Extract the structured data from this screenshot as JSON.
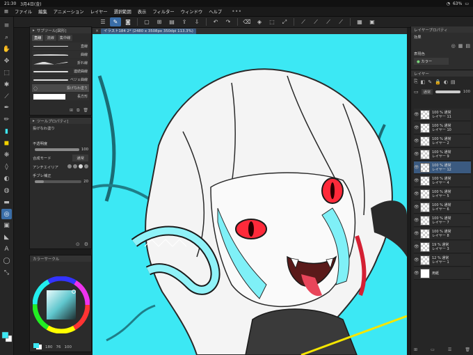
{
  "status": {
    "time": "21:30",
    "date": "3月4日(金)",
    "battery": "63%"
  },
  "menu": [
    "ファイル",
    "編集",
    "アニメーション",
    "レイヤー",
    "選択範囲",
    "表示",
    "フィルター",
    "ウィンドウ",
    "ヘルプ"
  ],
  "canvas_tab": {
    "title": "イラスト184 2* (2480 x 3508px 350dpi 113.3%)"
  },
  "subtool": {
    "header": "サブツール[図形]",
    "tabs": [
      "直線",
      "流線",
      "集中線"
    ],
    "brushes": [
      "直線",
      "曲線",
      "折れ線",
      "連続曲線",
      "ベジェ曲線",
      "投げなわ塗り",
      "長方形"
    ]
  },
  "toolprop": {
    "header": "ツールプロパティ[",
    "tool_name": "投げなわ塗り",
    "opacity_label": "不透明度",
    "opacity_value": "100",
    "blend_label": "合成モード",
    "blend_value": "通常",
    "aa_label": "アンチエイリア",
    "stabilize_label": "手ブレ補正",
    "stabilize_value": "20"
  },
  "color": {
    "header": "カラーサークル",
    "h": "180",
    "s": "76",
    "v": "100",
    "main_color": "#3ce8f4",
    "sub_color": "#ffffff"
  },
  "right": {
    "layerprop_header": "レイヤープロパティ",
    "effect_label": "効果",
    "express_label": "表現色",
    "express_value": "カラー",
    "layer_header": "レイヤー",
    "blend_value": "通常",
    "opacity_value": "100"
  },
  "layers": [
    {
      "pct": "100 %  通常",
      "name": "レイヤー 11"
    },
    {
      "pct": "100 %  通常",
      "name": "レイヤー 10"
    },
    {
      "pct": "100 %  通常",
      "name": "レイヤー 2"
    },
    {
      "pct": "100 %  通常",
      "name": "レイヤー 9"
    },
    {
      "pct": "100 %  通常",
      "name": "レイヤー 12"
    },
    {
      "pct": "100 %  通常",
      "name": "レイヤー 4"
    },
    {
      "pct": "100 %  通常",
      "name": "レイヤー 5"
    },
    {
      "pct": "100 %  通常",
      "name": "レイヤー 6"
    },
    {
      "pct": "100 %  通常",
      "name": "レイヤー 7"
    },
    {
      "pct": "100 %  通常",
      "name": "レイヤー 8"
    },
    {
      "pct": "19 %  通常",
      "name": "レイヤー 3"
    },
    {
      "pct": "12 %  通常",
      "name": "レイヤー 1"
    },
    {
      "pct": "",
      "name": "用紙"
    }
  ]
}
